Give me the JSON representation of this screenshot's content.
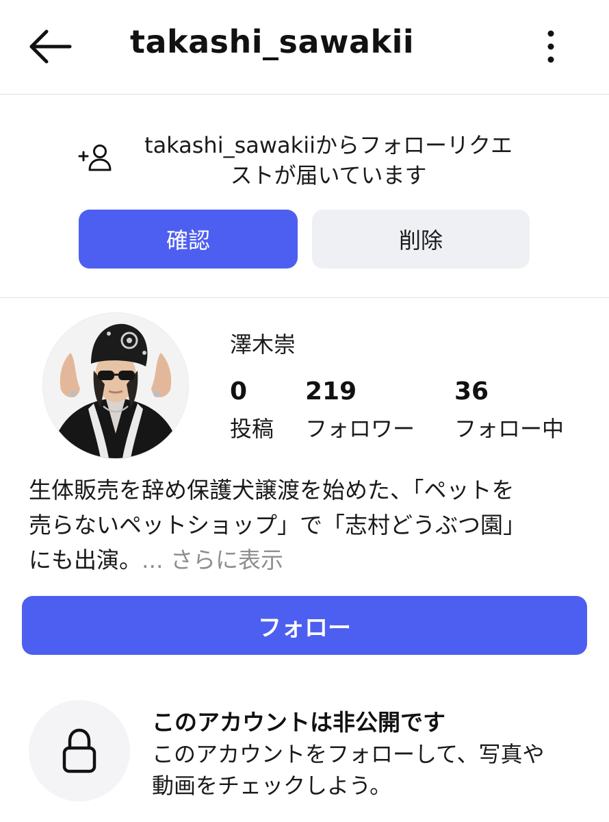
{
  "header": {
    "username": "takashi_sawakii",
    "back_icon": "arrow-left-icon",
    "menu_icon": "more-vertical-icon"
  },
  "follow_request": {
    "icon": "add-person-icon",
    "message_line1": "takashi_sawakiiからフォローリクエ",
    "message_line2": "ストが届いています",
    "confirm_label": "確認",
    "delete_label": "削除"
  },
  "profile": {
    "display_name": "澤木崇",
    "stats": [
      {
        "value": "0",
        "label": "投稿"
      },
      {
        "value": "219",
        "label": "フォロワー"
      },
      {
        "value": "36",
        "label": "フォロー中"
      }
    ],
    "bio_line1": "生体販売を辞め保護犬譲渡を始めた、「ペットを",
    "bio_line2": "売らないペットショップ」で「志村どうぶつ園」",
    "bio_line3": "にも出演。",
    "bio_more": "... さらに表示",
    "follow_label": "フォロー"
  },
  "private_notice": {
    "icon": "lock-icon",
    "title": "このアカウントは非公開です",
    "desc_line1": "このアカウントをフォローして、写真や",
    "desc_line2": "動画をチェックしよう。"
  },
  "colors": {
    "accent": "#4d5ff0",
    "secondary_button": "#eff0f4",
    "muted_text": "#8e8e8e",
    "divider": "#e0e0e0"
  }
}
